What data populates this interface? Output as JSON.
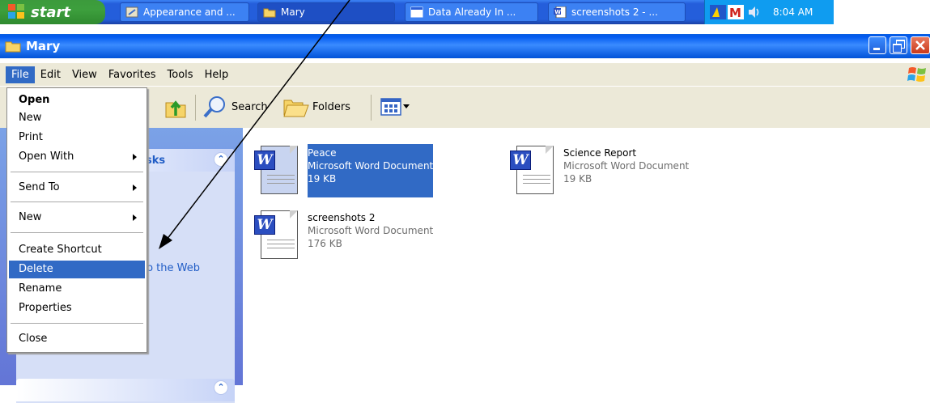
{
  "taskbar": {
    "start_label": "start",
    "tasks": [
      "Appearance and ...",
      "Mary",
      "Data Already In ...",
      "screenshots 2 - ..."
    ],
    "clock": "8:04 AM"
  },
  "window": {
    "title": "Mary"
  },
  "menubar": {
    "items": [
      "File",
      "Edit",
      "View",
      "Favorites",
      "Tools",
      "Help"
    ]
  },
  "toolbar": {
    "search_label": "Search",
    "folders_label": "Folders"
  },
  "task_pane": {
    "panel_title_fragment": "sks",
    "link_fragment": "to the Web"
  },
  "file_menu": {
    "items": [
      "Open",
      "New",
      "Print",
      "Open With",
      "Send To",
      "New",
      "Create Shortcut",
      "Delete",
      "Rename",
      "Properties",
      "Close"
    ],
    "highlighted": "Delete"
  },
  "files": [
    {
      "name": "Peace",
      "type": "Microsoft Word Document",
      "size": "19 KB",
      "selected": true
    },
    {
      "name": "Science Report",
      "type": "Microsoft Word Document",
      "size": "19 KB",
      "selected": false
    },
    {
      "name": "screenshots 2",
      "type": "Microsoft Word Document",
      "size": "176 KB",
      "selected": false
    }
  ],
  "colors": {
    "selection": "#316ac5",
    "taskbar": "#245edb",
    "titlebar": "#0058ee",
    "menu_bg": "#ece9d8",
    "task_pane_link": "#215dc6"
  }
}
